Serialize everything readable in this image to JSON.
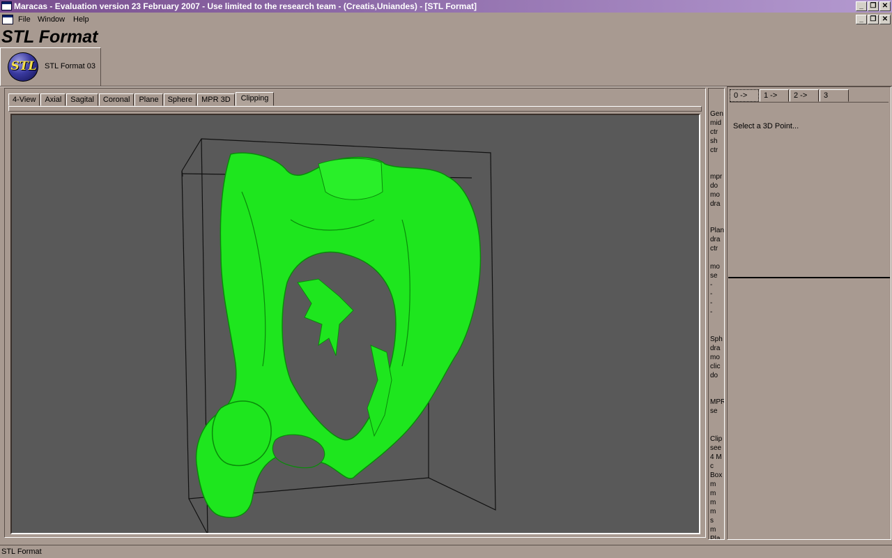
{
  "window": {
    "title": "Maracas - Evaluation version 23 February 2007 - Use limited to the research team - (Creatis,Uniandes) - [STL Format]",
    "minimize_glyph": "_",
    "restore_glyph": "❐",
    "close_glyph": "✕"
  },
  "menu": {
    "items": [
      "File",
      "Window",
      "Help"
    ]
  },
  "app_title": "STL Format",
  "toolbox": {
    "logo_text": "STL",
    "label": "STL Format 03"
  },
  "tabs": [
    "4-View",
    "Axial",
    "Sagital",
    "Coronal",
    "Plane",
    "Sphere",
    "MPR 3D",
    "Clipping"
  ],
  "active_tab": "Clipping",
  "viewport": {
    "background": "#595959",
    "model_color": "#1ee61e"
  },
  "side_help": [
    "Gen",
    "mid",
    "ctr",
    "sh",
    "ctr",
    "mpr",
    "do",
    "mo",
    "dra",
    "Plan",
    "dra",
    "ctr",
    "mo",
    "se",
    "-",
    "-",
    "-",
    "-",
    "Sph",
    "dra",
    "mo",
    "clic",
    "do",
    "MPR",
    "se",
    "Clip",
    "see",
    "4 M",
    "c",
    "Box",
    "m",
    "m",
    "m",
    "m",
    "s",
    "m",
    "Pla"
  ],
  "right_tabs": [
    "0 ->",
    "1 ->",
    "2 ->",
    "3"
  ],
  "right_message": "Select a 3D Point...",
  "status": "STL Format"
}
